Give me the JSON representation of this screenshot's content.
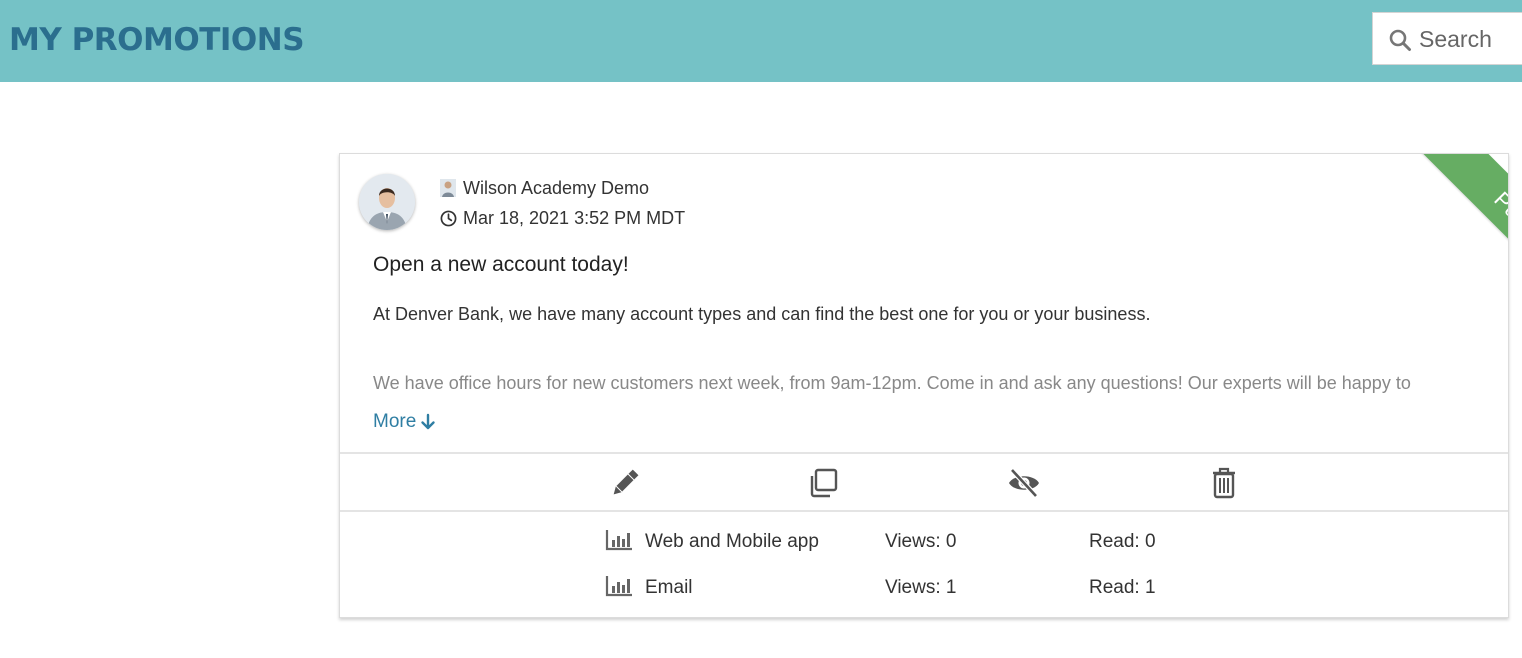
{
  "header": {
    "title": "MY PROMOTIONS",
    "search": {
      "placeholder": "Search",
      "value": ""
    }
  },
  "promotion": {
    "author": "Wilson Academy Demo",
    "timestamp": "Mar 18, 2021 3:52 PM MDT",
    "status": "Published",
    "title": "Open a new account today!",
    "paragraphs": [
      "At Denver Bank, we have many account types and can find the best one for you or your business.",
      "We have office hours for new customers next week, from 9am-12pm. Come in and ask any questions! Our experts will be happy to"
    ],
    "more_label": "More",
    "actions": [
      {
        "icon": "pencil-icon",
        "name": "edit"
      },
      {
        "icon": "copy-icon",
        "name": "duplicate"
      },
      {
        "icon": "eye-slash-icon",
        "name": "unpublish"
      },
      {
        "icon": "trash-icon",
        "name": "delete"
      }
    ],
    "stats": [
      {
        "icon": "bar-chart-icon",
        "channel": "Web and Mobile app",
        "views": "Views: 0",
        "read": "Read: 0"
      },
      {
        "icon": "bar-chart-icon",
        "channel": "Email",
        "views": "Views: 1",
        "read": "Read: 1"
      }
    ]
  },
  "colors": {
    "header_bg": "#75c2c6",
    "title": "#2b6e8e",
    "status_ribbon": "#66ad63",
    "link": "#2f7ea3"
  }
}
